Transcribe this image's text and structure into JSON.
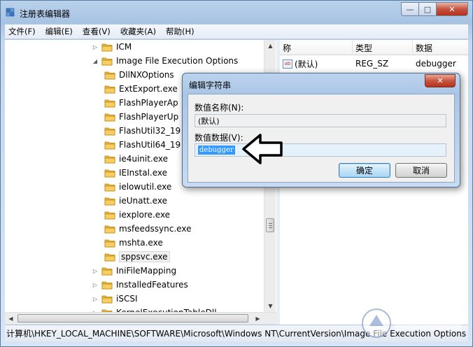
{
  "window": {
    "title": "注册表编辑器",
    "caption": {
      "minimize": "—",
      "maximize": "□",
      "close": "✕"
    }
  },
  "menu": [
    "文件(F)",
    "编辑(E)",
    "查看(V)",
    "收藏夹(A)",
    "帮助(H)"
  ],
  "tree": {
    "items": [
      {
        "label": "ICM",
        "expander": "▷"
      },
      {
        "label": "Image File Execution Options",
        "expander": "◢"
      },
      {
        "label": "DllNXOptions"
      },
      {
        "label": "ExtExport.exe"
      },
      {
        "label": "FlashPlayerAp"
      },
      {
        "label": "FlashPlayerUp"
      },
      {
        "label": "FlashUtil32_19"
      },
      {
        "label": "FlashUtil64_19"
      },
      {
        "label": "ie4uinit.exe"
      },
      {
        "label": "IEInstal.exe"
      },
      {
        "label": "ielowutil.exe"
      },
      {
        "label": "ieUnatt.exe"
      },
      {
        "label": "iexplore.exe"
      },
      {
        "label": "msfeedssync.exe"
      },
      {
        "label": "mshta.exe"
      },
      {
        "label": "sppsvc.exe",
        "selected": true
      },
      {
        "label": "IniFileMapping",
        "expander": "▷"
      },
      {
        "label": "InstalledFeatures",
        "expander": "▷"
      },
      {
        "label": "iSCSI",
        "expander": "▷"
      },
      {
        "label": "KernelExecutionTableDll",
        "expander": "▷"
      }
    ]
  },
  "list": {
    "headers": [
      "称",
      "类型",
      "数据"
    ],
    "rows": [
      {
        "name": "(默认)",
        "type": "REG_SZ",
        "data": "debugger",
        "icon": "ab"
      }
    ]
  },
  "statusbar": {
    "path": "计算机\\HKEY_LOCAL_MACHINE\\SOFTWARE\\Microsoft\\Windows NT\\CurrentVersion\\Image File Execution Options"
  },
  "dialog": {
    "title": "编辑字符串",
    "close": "✕",
    "name_label": "数值名称(N):",
    "name_value": "(默认)",
    "data_label": "数值数据(V):",
    "data_value": "debugger",
    "ok_label": "确定",
    "cancel_label": "取消"
  },
  "colors": {
    "selection": "#3399ff",
    "folder": "#e8b53b",
    "close_red": "#c9553f",
    "aero_blue": "#b9d1ea"
  }
}
